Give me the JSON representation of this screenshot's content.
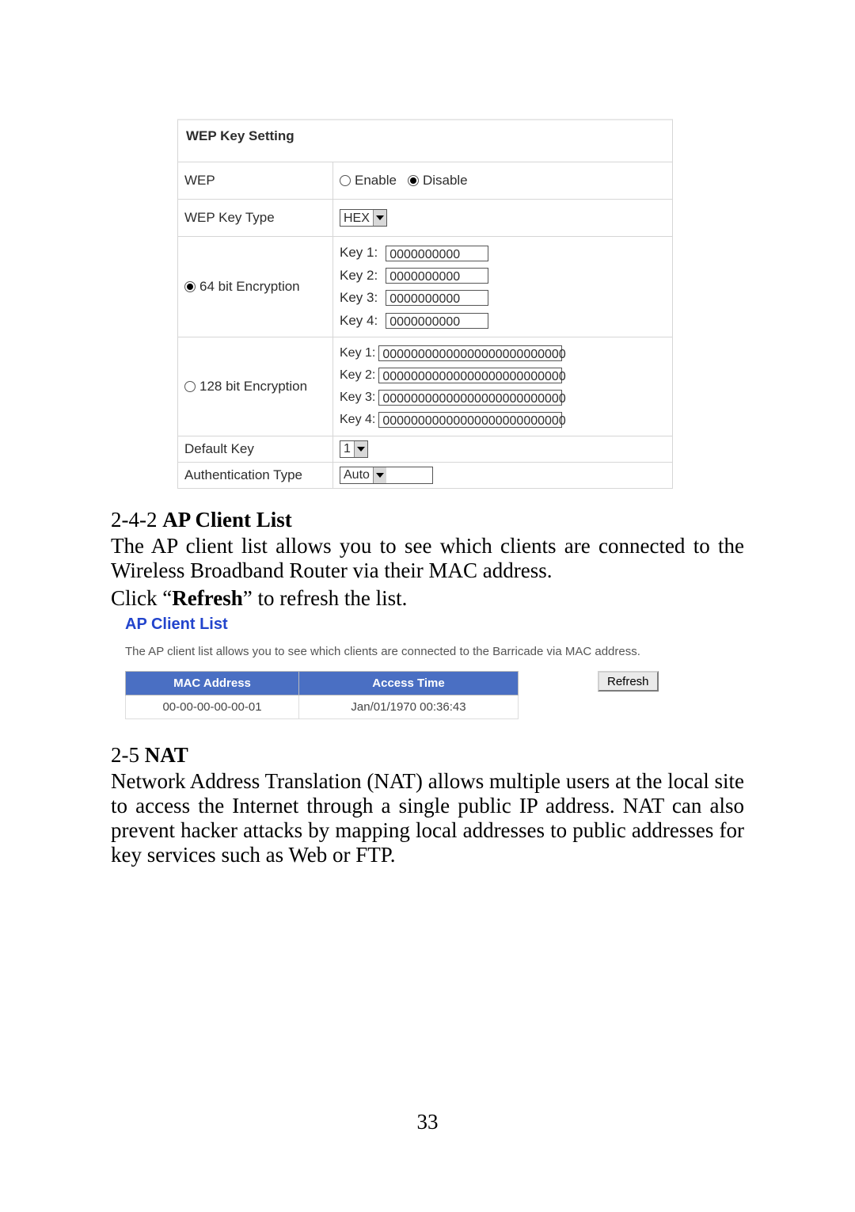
{
  "wep": {
    "title": "WEP Key Setting",
    "row_wep_label": "WEP",
    "enable_label": "Enable",
    "disable_label": "Disable",
    "row_type_label": "WEP Key Type",
    "key_type_value": "HEX",
    "enc64_label": "64 bit Encryption",
    "enc128_label": "128 bit Encryption",
    "keys64": [
      {
        "label": "Key 1:",
        "value": "0000000000"
      },
      {
        "label": "Key 2:",
        "value": "0000000000"
      },
      {
        "label": "Key 3:",
        "value": "0000000000"
      },
      {
        "label": "Key 4:",
        "value": "0000000000"
      }
    ],
    "keys128": [
      {
        "label": "Key 1:",
        "value": "00000000000000000000000000"
      },
      {
        "label": "Key 2:",
        "value": "00000000000000000000000000"
      },
      {
        "label": "Key 3:",
        "value": "00000000000000000000000000"
      },
      {
        "label": "Key 4:",
        "value": "00000000000000000000000000"
      }
    ],
    "default_key_label": "Default Key",
    "default_key_value": "1",
    "auth_type_label": "Authentication Type",
    "auth_type_value": "Auto"
  },
  "doc": {
    "sect1_num": "2-4-2 ",
    "sect1_title": "AP Client List",
    "para1": "The AP client list allows you to see which clients are connected to the Wireless Broadband Router via their MAC address.",
    "para2_pre": "Click “",
    "para2_bold": "Refresh",
    "para2_post": "” to refresh the list.",
    "sect2_num": "2-5 ",
    "sect2_title": "NAT",
    "para3": "Network Address Translation (NAT) allows multiple users at the local site to access the Internet through a single public IP address. NAT can also prevent hacker attacks by mapping local addresses to public addresses for key services such as Web or FTP.",
    "page_number": "33"
  },
  "ap": {
    "title": "AP Client List",
    "desc": "The AP client list allows you to see which clients are connected to the Barricade via MAC address.",
    "col1": "MAC Address",
    "col2": "Access Time",
    "row_mac": "00-00-00-00-00-01",
    "row_time": "Jan/01/1970 00:36:43",
    "refresh": "Refresh"
  }
}
